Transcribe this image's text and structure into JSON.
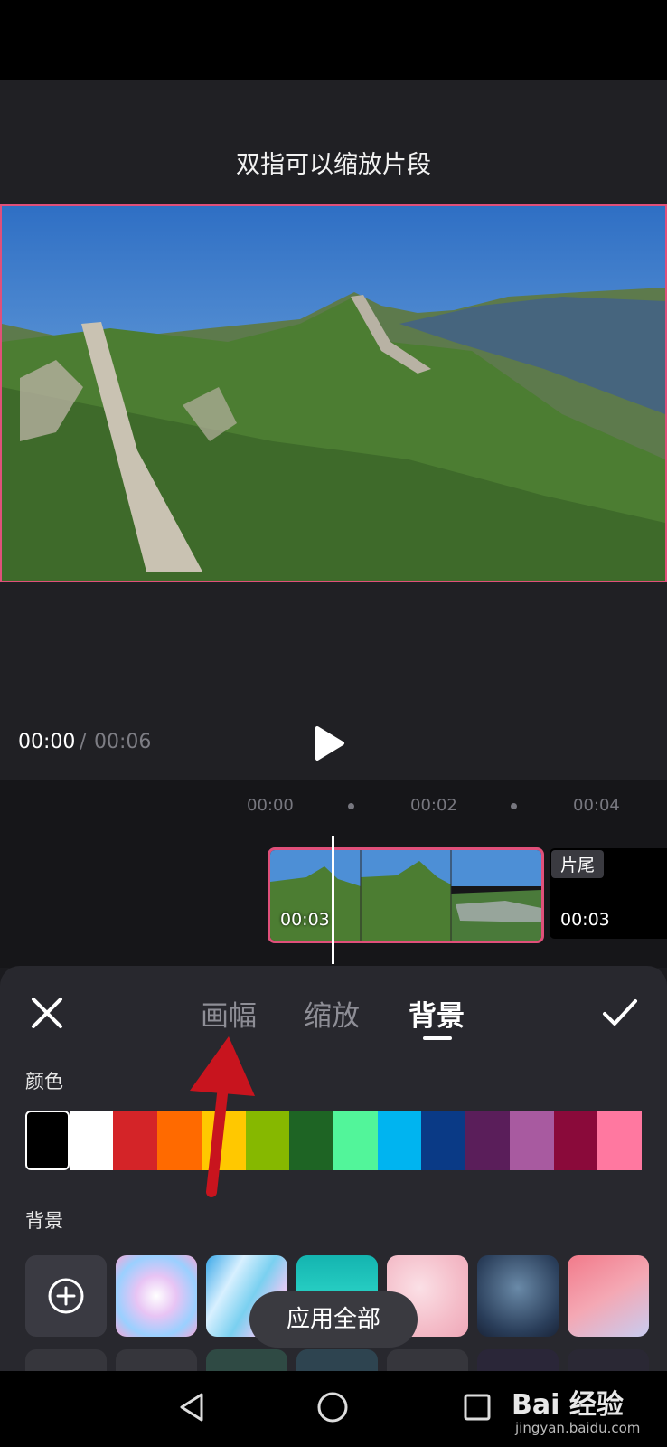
{
  "preview": {
    "hint": "双指可以缩放片段",
    "time_current": "00:00",
    "time_separator": "/",
    "time_total": "00:06"
  },
  "timeline": {
    "ticks": [
      "00:00",
      "00:02",
      "00:04"
    ],
    "clip_duration": "00:03",
    "end_label": "片尾",
    "end_duration": "00:03"
  },
  "panel": {
    "tabs": [
      "画幅",
      "缩放",
      "背景"
    ],
    "active_tab": "背景",
    "color_label": "颜色",
    "background_label": "背景",
    "colors": [
      "#000000",
      "#ffffff",
      "#d42428",
      "#ff6a00",
      "#ffc800",
      "#86b800",
      "#1e6424",
      "#52f59a",
      "#00b4f0",
      "#0a3a86",
      "#5a1e5a",
      "#a85aa0",
      "#8a0a3a",
      "#ff78a0"
    ],
    "apply_all": "应用全部"
  },
  "watermark": {
    "brand": "Bai 经验",
    "site": "jingyan.baidu.com"
  },
  "accent_color": "#e0507a"
}
